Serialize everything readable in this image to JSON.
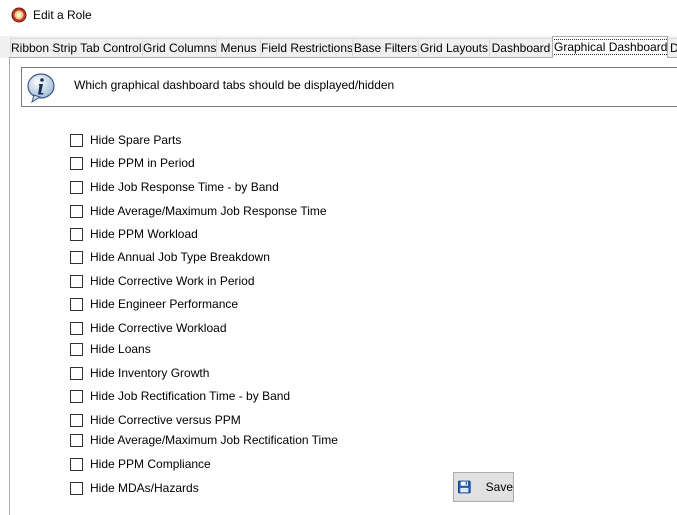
{
  "window": {
    "title": "Edit a Role",
    "icon": "app-icon"
  },
  "tabs": [
    {
      "label": "Ribbon Strip Tab Controls",
      "active": false
    },
    {
      "label": "Grid Columns",
      "active": false
    },
    {
      "label": "Menus",
      "active": false
    },
    {
      "label": "Field Restrictions",
      "active": false
    },
    {
      "label": "Base Filters",
      "active": false
    },
    {
      "label": "Grid Layouts",
      "active": false
    },
    {
      "label": "Dashboard",
      "active": false
    },
    {
      "label": "Graphical Dashboard",
      "active": true
    },
    {
      "label": "D",
      "active": false
    }
  ],
  "info": {
    "icon": "info-icon",
    "text": "Which graphical dashboard tabs should be displayed/hidden"
  },
  "options": [
    {
      "label": "Hide Spare Parts",
      "checked": false
    },
    {
      "label": "Hide PPM in Period",
      "checked": false
    },
    {
      "label": "Hide Job Response Time - by Band",
      "checked": false
    },
    {
      "label": "Hide Average/Maximum Job Response Time",
      "checked": false
    },
    {
      "label": "Hide PPM Workload",
      "checked": false
    },
    {
      "label": "Hide Annual Job Type Breakdown",
      "checked": false
    },
    {
      "label": "Hide Corrective Work in Period",
      "checked": false
    },
    {
      "label": "Hide Engineer Performance",
      "checked": false
    },
    {
      "label": "Hide Corrective Workload",
      "checked": false
    },
    {
      "label": "Hide Loans",
      "checked": false
    },
    {
      "label": "Hide Inventory Growth",
      "checked": false
    },
    {
      "label": "Hide Job Rectification Time - by Band",
      "checked": false
    },
    {
      "label": "Hide Corrective versus PPM",
      "checked": false
    },
    {
      "label": "Hide Average/Maximum Job Rectification Time",
      "checked": false
    },
    {
      "label": "Hide PPM Compliance",
      "checked": false
    },
    {
      "label": "Hide MDAs/Hazards",
      "checked": false
    }
  ],
  "save_button": {
    "label": "Save",
    "icon": "floppy-disk-icon"
  }
}
